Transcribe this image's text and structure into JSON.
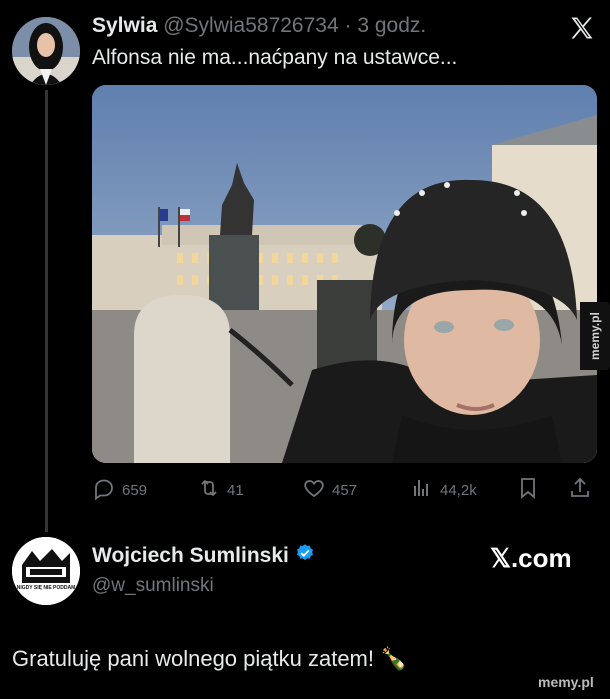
{
  "tweet1": {
    "display_name": "Sylwia",
    "handle": "@Sylwia58726734",
    "time": "· 3 godz.",
    "text": "Alfonsa nie ma...naćpany na ustawce...",
    "stats": {
      "replies": "659",
      "reposts": "41",
      "likes": "457",
      "views": "44,2k"
    }
  },
  "tweet2": {
    "display_name": "Wojciech Sumlinski",
    "handle": "@w_sumlinski",
    "avatar_text": "NIGDY SIĘ NIE PODDAM",
    "text": "Gratuluję pani wolnego piątku zatem! 🍾"
  },
  "branding": {
    "xcom": "𝕏.com",
    "watermark_side": "memy.pl",
    "watermark_bottom": "memy.pl"
  },
  "icons": {
    "x_logo": "x-logo-icon",
    "reply": "reply-icon",
    "repost": "repost-icon",
    "like": "heart-icon",
    "views": "views-icon",
    "bookmark": "bookmark-icon",
    "share": "share-icon",
    "verified": "verified-badge-icon"
  },
  "colors": {
    "background": "#000000",
    "text": "#e7e9ea",
    "muted": "#71767b",
    "verified": "#1d9bf0"
  }
}
